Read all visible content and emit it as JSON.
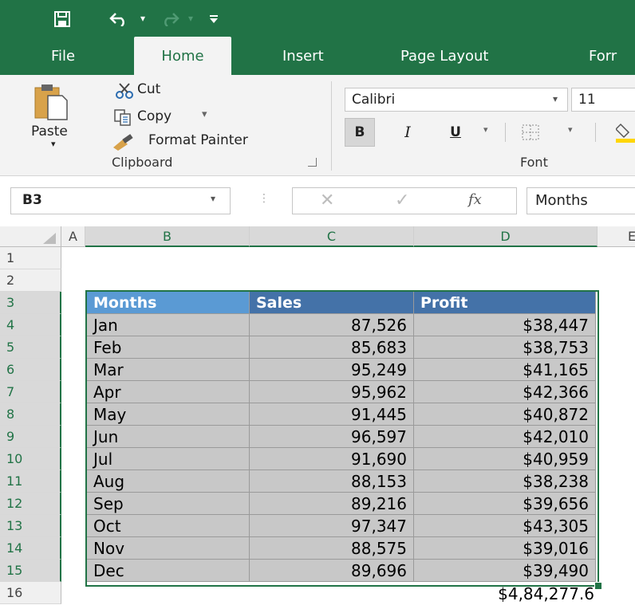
{
  "qat": {
    "save_icon": "save-icon",
    "undo_icon": "undo-icon",
    "redo_icon": "redo-icon",
    "customize_icon": "customize-qat-icon"
  },
  "tabs": [
    "File",
    "Home",
    "Insert",
    "Page Layout",
    "Forr"
  ],
  "ribbon": {
    "clipboard": {
      "paste": "Paste",
      "cut": "Cut",
      "copy": "Copy",
      "format_painter": "Format Painter",
      "label": "Clipboard"
    },
    "font": {
      "font_name": "Calibri",
      "font_size": "11",
      "bold": "B",
      "italic": "I",
      "underline": "U",
      "label": "Font"
    }
  },
  "formula_bar": {
    "name_box": "B3",
    "fx": "fx",
    "value": "Months"
  },
  "columns": [
    "A",
    "B",
    "C",
    "D",
    "E"
  ],
  "rows": [
    "1",
    "2",
    "3",
    "4",
    "5",
    "6",
    "7",
    "8",
    "9",
    "10",
    "11",
    "12",
    "13",
    "14",
    "15",
    "16"
  ],
  "table": {
    "headers": [
      "Months",
      "Sales",
      "Profit"
    ],
    "data": [
      [
        "Jan",
        "87,526",
        "$38,447"
      ],
      [
        "Feb",
        "85,683",
        "$38,753"
      ],
      [
        "Mar",
        "95,249",
        "$41,165"
      ],
      [
        "Apr",
        "95,962",
        "$42,366"
      ],
      [
        "May",
        "91,445",
        "$40,872"
      ],
      [
        "Jun",
        "96,597",
        "$42,010"
      ],
      [
        "Jul",
        "91,690",
        "$40,959"
      ],
      [
        "Aug",
        "88,153",
        "$38,238"
      ],
      [
        "Sep",
        "89,216",
        "$39,656"
      ],
      [
        "Oct",
        "97,347",
        "$43,305"
      ],
      [
        "Nov",
        "88,575",
        "$39,016"
      ],
      [
        "Dec",
        "89,696",
        "$39,490"
      ]
    ],
    "total": "$4,84,277.6"
  },
  "colors": {
    "brand": "#217346",
    "header_first": "#5a9ad4",
    "header": "#4472a8",
    "cell_fill": "#c8c8c8"
  }
}
